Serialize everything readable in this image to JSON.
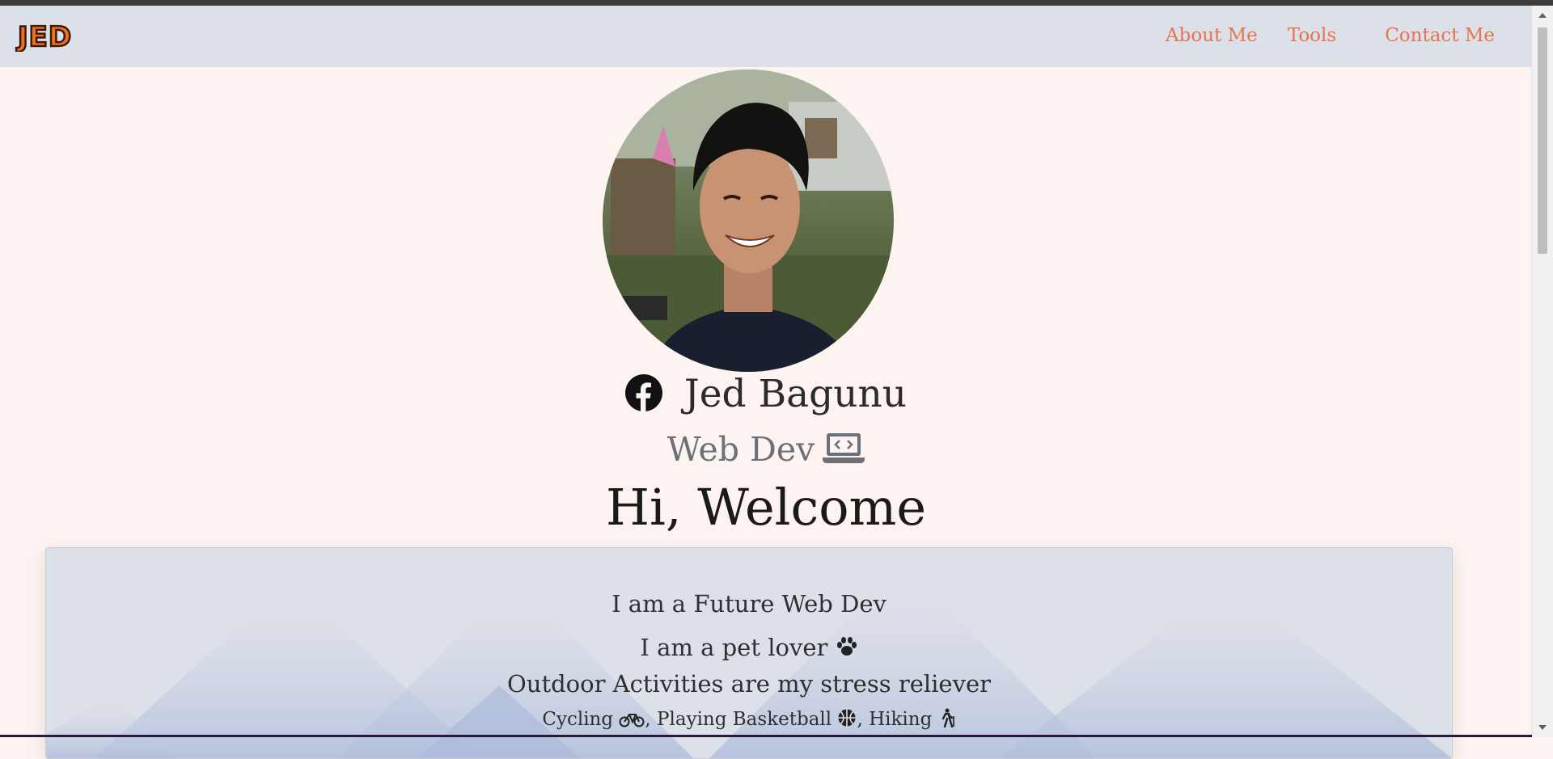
{
  "brand": {
    "logo_text": "JED"
  },
  "nav": {
    "about": "About Me",
    "tools": "Tools",
    "contact": "Contact Me"
  },
  "profile": {
    "name": "Jed Bagunu",
    "role": "Web Dev",
    "welcome": "Hi, Welcome"
  },
  "about_card": {
    "line1": "I am a Future Web Dev",
    "line2": "I am a pet lover",
    "line3": "Outdoor Activities are my stress reliever",
    "hobby1": "Cycling",
    "hobby2": "Playing Basketball",
    "hobby3": "Hiking"
  },
  "colors": {
    "nav_link": "#e8734f",
    "navbar_bg": "#dce0e8",
    "page_bg": "#fdf3f0",
    "logo_fill": "#f3711c"
  },
  "icons": [
    "facebook-icon",
    "laptop-code-icon",
    "paw-icon",
    "bicycle-icon",
    "basketball-icon",
    "hiking-icon"
  ]
}
